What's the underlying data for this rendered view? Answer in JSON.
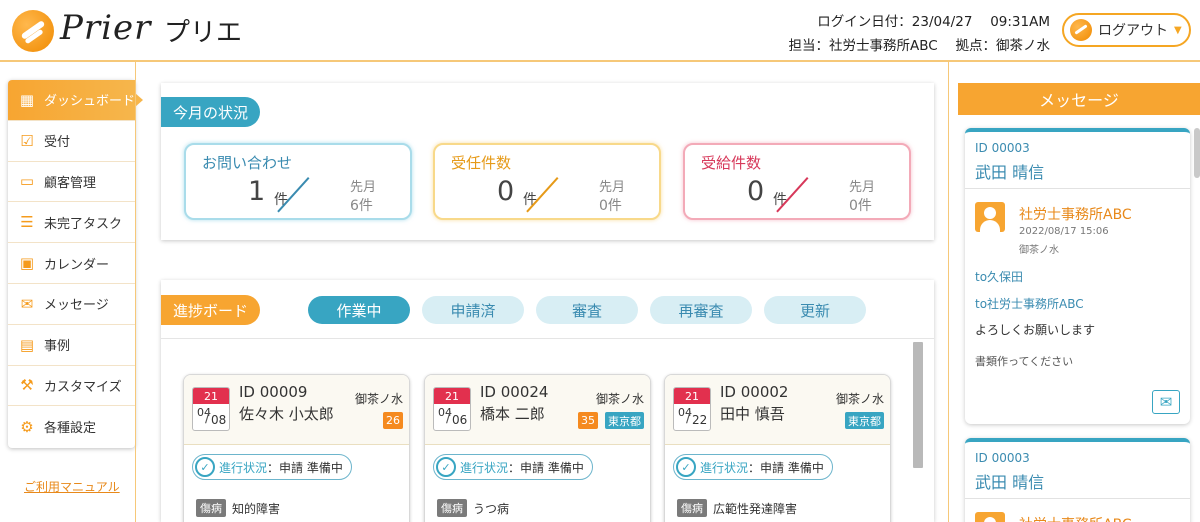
{
  "header": {
    "logo_text": "Prier",
    "app_name": "プリエ",
    "login_label": "ログイン日付：23/04/27　 09:31AM",
    "staff_label": "担当：社労士事務所ABC　 拠点：御茶ノ水",
    "logout_label": "ログアウト"
  },
  "sidebar": {
    "items": [
      {
        "label": "ダッシュボード",
        "icon": "dashboard-icon"
      },
      {
        "label": "受付",
        "icon": "clipboard-check-icon"
      },
      {
        "label": "顧客管理",
        "icon": "folder-icon"
      },
      {
        "label": "未完了タスク",
        "icon": "task-list-icon"
      },
      {
        "label": "カレンダー",
        "icon": "calendar-icon"
      },
      {
        "label": "メッセージ",
        "icon": "mail-icon"
      },
      {
        "label": "事例",
        "icon": "clipboard-icon"
      },
      {
        "label": "カスタマイズ",
        "icon": "wrench-icon"
      },
      {
        "label": "各種設定",
        "icon": "gear-icon"
      }
    ],
    "manual_link": "ご利用マニュアル"
  },
  "status": {
    "title": "今月の状況",
    "cards": [
      {
        "title": "お問い合わせ",
        "value": "1",
        "unit": "件",
        "prev_label": "先月",
        "prev_value": "6件"
      },
      {
        "title": "受任件数",
        "value": "0",
        "unit": "件",
        "prev_label": "先月",
        "prev_value": "0件"
      },
      {
        "title": "受給件数",
        "value": "0",
        "unit": "件",
        "prev_label": "先月",
        "prev_value": "0件"
      }
    ]
  },
  "progress": {
    "title": "進捗ボード",
    "filters": [
      "作業中",
      "申請済",
      "審査",
      "再審査",
      "更新"
    ],
    "active_filter": "作業中",
    "cards": [
      {
        "cal_day": "21",
        "month": "04",
        "day": "08",
        "id": "ID 00009",
        "name": "佐々木 小太郎",
        "location": "御茶ノ水",
        "badge_num": "26",
        "badge_pref": "",
        "status_label": "進行状況",
        "status_value": "：申請 準備中",
        "disease_tag": "傷病",
        "disease": "知的障害"
      },
      {
        "cal_day": "21",
        "month": "04",
        "day": "06",
        "id": "ID 00024",
        "name": "橋本 二郎",
        "location": "御茶ノ水",
        "badge_num": "35",
        "badge_pref": "東京都",
        "status_label": "進行状況",
        "status_value": "：申請 準備中",
        "disease_tag": "傷病",
        "disease": "うつ病"
      },
      {
        "cal_day": "21",
        "month": "04",
        "day": "22",
        "id": "ID 00002",
        "name": "田中 慎吾",
        "location": "御茶ノ水",
        "badge_num": "",
        "badge_pref": "東京都",
        "status_label": "進行状況",
        "status_value": "：申請 準備中",
        "disease_tag": "傷病",
        "disease": "広範性発達障害"
      }
    ]
  },
  "messages": {
    "title": "メッセージ",
    "items": [
      {
        "id": "ID 00003",
        "name": "武田 晴信",
        "from": "社労士事務所ABC",
        "date": "2022/08/17 15:06",
        "location": "御茶ノ水",
        "to1": "to久保田",
        "to2": "to社労士事務所ABC",
        "body1": "よろしくお願いします",
        "body2": "書類作ってください"
      },
      {
        "id": "ID 00003",
        "name": "武田 晴信",
        "from": "社労士事務所ABC"
      }
    ]
  },
  "colors": {
    "accent_orange": "#f7a531",
    "accent_teal": "#38a5c2",
    "alert_red": "#e2304e"
  }
}
